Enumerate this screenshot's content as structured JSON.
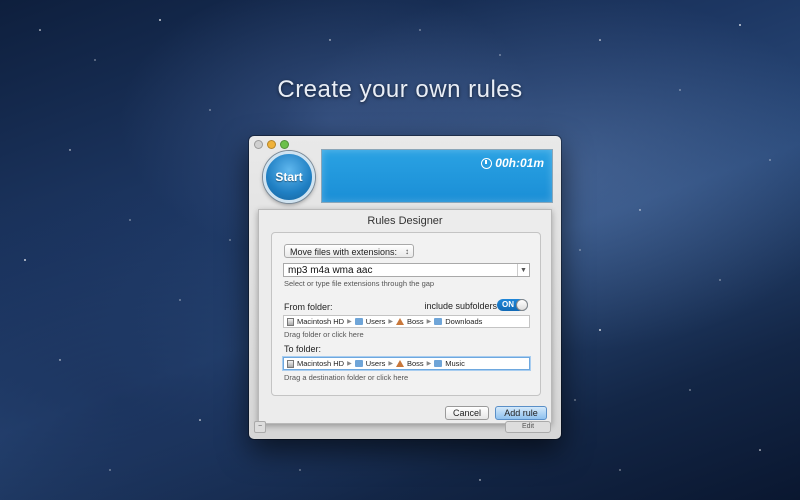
{
  "headline": "Create your own rules",
  "timer": "00h:01m",
  "start_label": "Start",
  "sheet": {
    "title": "Rules Designer",
    "action_select": "Move files with extensions:",
    "extensions_value": "mp3 m4a wma aac",
    "extensions_hint": "Select or type file extensions through the gap",
    "from_label": "From folder:",
    "include_subfolders_label": "include subfolders",
    "toggle_label": "ON",
    "from_path": [
      "Macintosh HD",
      "Users",
      "Boss",
      "Downloads"
    ],
    "from_hint": "Drag folder or click here",
    "to_label": "To folder:",
    "to_path": [
      "Macintosh HD",
      "Users",
      "Boss",
      "Music"
    ],
    "to_hint": "Drag a destination folder or click here",
    "cancel_label": "Cancel",
    "add_label": "Add rule"
  },
  "background_buttons": {
    "edit_label": "Edit"
  }
}
